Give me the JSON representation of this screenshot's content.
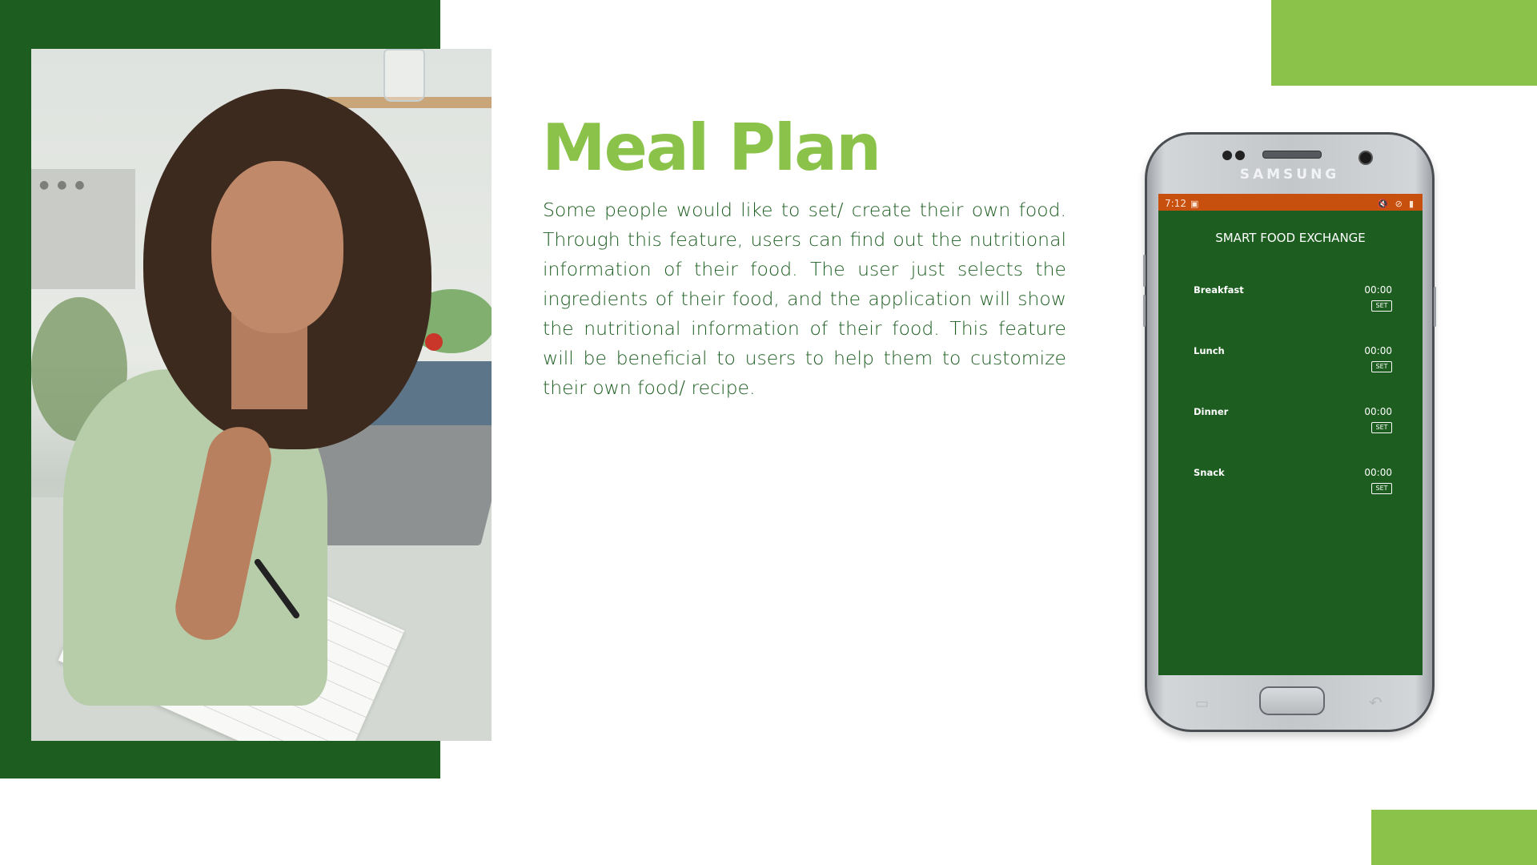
{
  "slide": {
    "title": "Meal Plan",
    "body": "Some people would like to set/ create their own food. Through this feature, users can find out the nutritional information of their food. The user just selects the ingredients of their food, and the application will show the nutritional information of their food. This feature will be beneficial to users to help them to customize their own food/ recipe.",
    "colors": {
      "dark_green": "#1d5e20",
      "accent_green": "#8bc34a",
      "status_orange": "#c7500f"
    }
  },
  "phone": {
    "brand": "SAMSUNG",
    "status_bar": {
      "time": "7:12",
      "icons": [
        "image-icon",
        "mute-icon",
        "no-disturb-icon",
        "battery-icon"
      ]
    },
    "app": {
      "title": "SMART FOOD EXCHANGE",
      "meals": [
        {
          "label": "Breakfast",
          "time": "00:00",
          "button": "SET"
        },
        {
          "label": "Lunch",
          "time": "00:00",
          "button": "SET"
        },
        {
          "label": "Dinner",
          "time": "00:00",
          "button": "SET"
        },
        {
          "label": "Snack",
          "time": "00:00",
          "button": "SET"
        }
      ]
    }
  }
}
